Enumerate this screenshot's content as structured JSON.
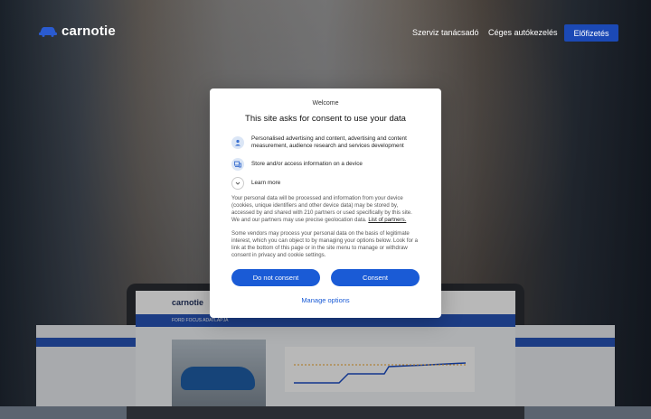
{
  "header": {
    "brand": "carnotie",
    "nav": [
      "Szerviz tanácsadó",
      "Céges autókezelés"
    ],
    "cta": "Előfizetés"
  },
  "laptop": {
    "brand": "carnotie",
    "band_title": "FORD FOCUS ADATLAPJA"
  },
  "consent": {
    "welcome": "Welcome",
    "title": "This site asks for consent to use your data",
    "purposes": [
      {
        "icon": "person-icon",
        "text": "Personalised advertising and content, advertising and content measurement, audience research and services development"
      },
      {
        "icon": "device-icon",
        "text": "Store and/or access information on a device"
      }
    ],
    "learn_more": "Learn more",
    "paragraph1": "Your personal data will be processed and information from your device (cookies, unique identifiers and other device data) may be stored by, accessed by and shared with 210 partners or used specifically by this site. We and our partners may use precise geolocation data.",
    "partners_link": "List of partners.",
    "paragraph2": "Some vendors may process your personal data on the basis of legitimate interest, which you can object to by managing your options below. Look for a link at the bottom of this page or in the site menu to manage or withdraw consent in privacy and cookie settings.",
    "do_not_consent": "Do not consent",
    "consent_btn": "Consent",
    "manage_options": "Manage options"
  },
  "colors": {
    "accent": "#1a5bd6",
    "header_cta": "#1b49b5"
  }
}
